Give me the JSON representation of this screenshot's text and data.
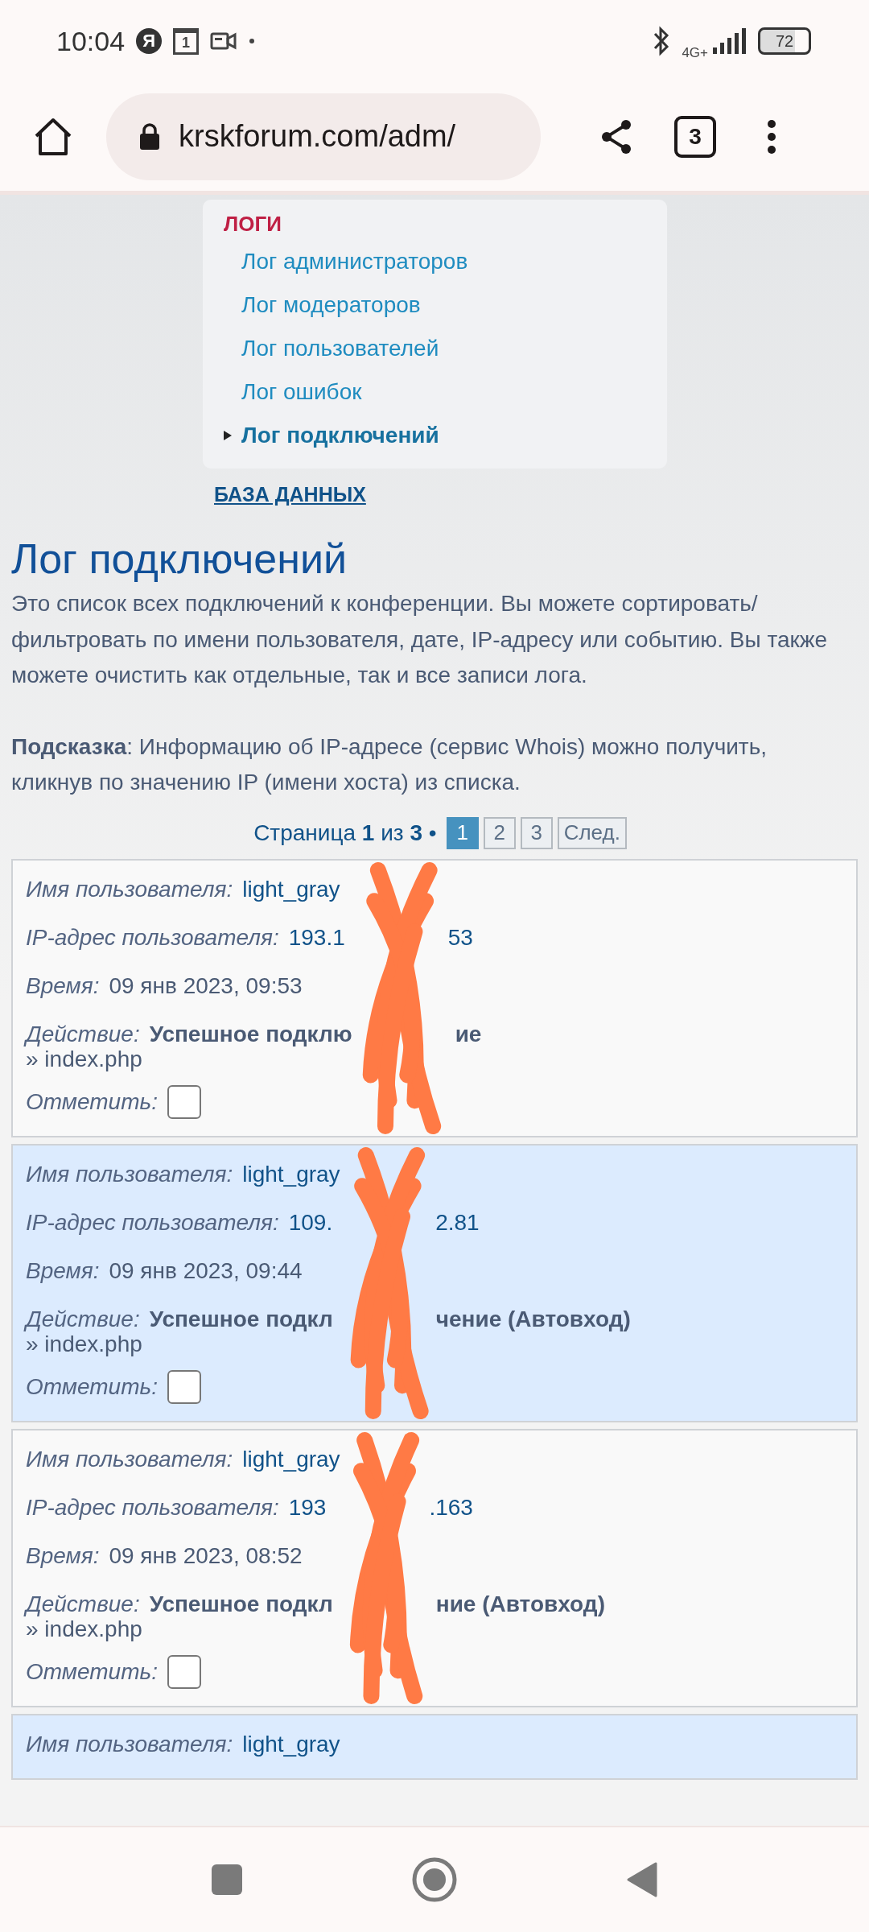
{
  "status_bar": {
    "time": "10:04",
    "app_badge": "Я",
    "calendar_day": "1",
    "network": "4G+",
    "battery": "72"
  },
  "browser": {
    "url": "krskforum.com/adm/",
    "tab_count": "3"
  },
  "menu": {
    "heading": "ЛОГИ",
    "items": [
      {
        "label": "Лог администраторов",
        "selected": false
      },
      {
        "label": "Лог модераторов",
        "selected": false
      },
      {
        "label": "Лог пользователей",
        "selected": false
      },
      {
        "label": "Лог ошибок",
        "selected": false
      },
      {
        "label": "Лог подключений",
        "selected": true
      }
    ]
  },
  "section_link": "БАЗА ДАННЫХ",
  "page_title": "Лог подключений",
  "description": "Это список всех подключений к конференции. Вы можете сортировать/фильтровать по имени пользователя, дате, IP-адресу или событию. Вы также можете очистить как отдельные, так и все записи лога.",
  "hint": "**Подсказка**: Информацию об IP-адресе (сервис Whois) можно получить, кликнув по значению IP (имени хоста) из списка.",
  "pagination": {
    "text": "Страница **1** из **3** •",
    "pages": [
      {
        "label": "1",
        "selected": true
      },
      {
        "label": "2",
        "selected": false
      },
      {
        "label": "3",
        "selected": false
      }
    ],
    "next": "След."
  },
  "entries": [
    {
      "highlighted": false,
      "fields": [
        {
          "kind": "link",
          "label": "Имя пользователя:",
          "value": [
            "light_gray"
          ]
        },
        {
          "kind": "link",
          "label": "IP-адрес пользователя:",
          "value": [
            "193.1",
            "53"
          ]
        },
        {
          "kind": "plain",
          "label": "Время:",
          "value": [
            "09 янв 2023, 09:53"
          ]
        },
        {
          "kind": "action",
          "label": "Действие:",
          "value": [
            "Успешное подклю",
            "ие"
          ]
        }
      ],
      "page": "» index.php",
      "mark_label": "Отметить:",
      "checked": false
    },
    {
      "highlighted": true,
      "fields": [
        {
          "kind": "link",
          "label": "Имя пользователя:",
          "value": [
            "light_gray"
          ]
        },
        {
          "kind": "link",
          "label": "IP-адрес пользователя:",
          "value": [
            "109.",
            "2.81"
          ]
        },
        {
          "kind": "plain",
          "label": "Время:",
          "value": [
            "09 янв 2023, 09:44"
          ]
        },
        {
          "kind": "action",
          "label": "Действие:",
          "value": [
            "Успешное подкл",
            "чение (Автовход)"
          ]
        }
      ],
      "page": "» index.php",
      "mark_label": "Отметить:",
      "checked": false
    },
    {
      "highlighted": false,
      "fields": [
        {
          "kind": "link",
          "label": "Имя пользователя:",
          "value": [
            "light_gray"
          ]
        },
        {
          "kind": "link",
          "label": "IP-адрес пользователя:",
          "value": [
            "193",
            ".163"
          ]
        },
        {
          "kind": "plain",
          "label": "Время:",
          "value": [
            "09 янв 2023, 08:52"
          ]
        },
        {
          "kind": "action",
          "label": "Действие:",
          "value": [
            "Успешное подкл",
            "ние (Автовход)"
          ]
        }
      ],
      "page": "» index.php",
      "mark_label": "Отметить:",
      "checked": false
    },
    {
      "highlighted": true,
      "fields": [
        {
          "kind": "link",
          "label": "Имя пользователя:",
          "value": [
            "light_gray"
          ]
        }
      ]
    }
  ]
}
